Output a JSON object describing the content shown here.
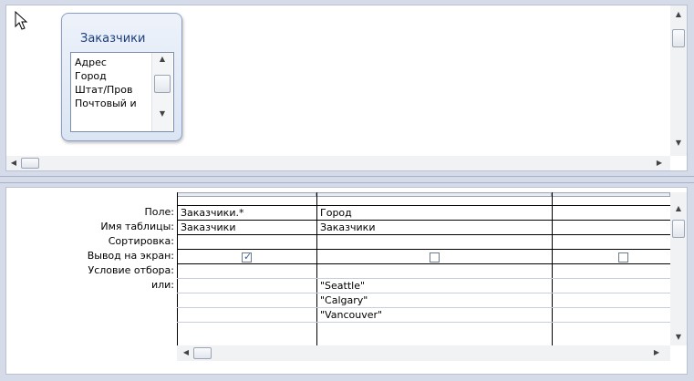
{
  "design_pane": {
    "table": {
      "title": "Заказчики",
      "fields": [
        "Адрес",
        "Город",
        "Штат/Пров",
        "Почтовый и"
      ]
    }
  },
  "grid": {
    "row_labels": [
      "Поле:",
      "Имя таблицы:",
      "Сортировка:",
      "Вывод на экран:",
      "Условие отбора:",
      "или:"
    ],
    "columns": [
      {
        "field": "Заказчики.*",
        "table": "Заказчики",
        "sort": "",
        "show": true,
        "criteria": "",
        "or": [
          "",
          ""
        ]
      },
      {
        "field": "Город",
        "table": "Заказчики",
        "sort": "",
        "show": false,
        "criteria": "\"Seattle\"",
        "or": [
          "\"Calgary\"",
          "\"Vancouver\""
        ]
      },
      {
        "field": "",
        "table": "",
        "sort": "",
        "show": false,
        "criteria": "",
        "or": [
          "",
          ""
        ]
      }
    ]
  },
  "icons": {
    "cursor": "mouse-pointer-icon"
  }
}
